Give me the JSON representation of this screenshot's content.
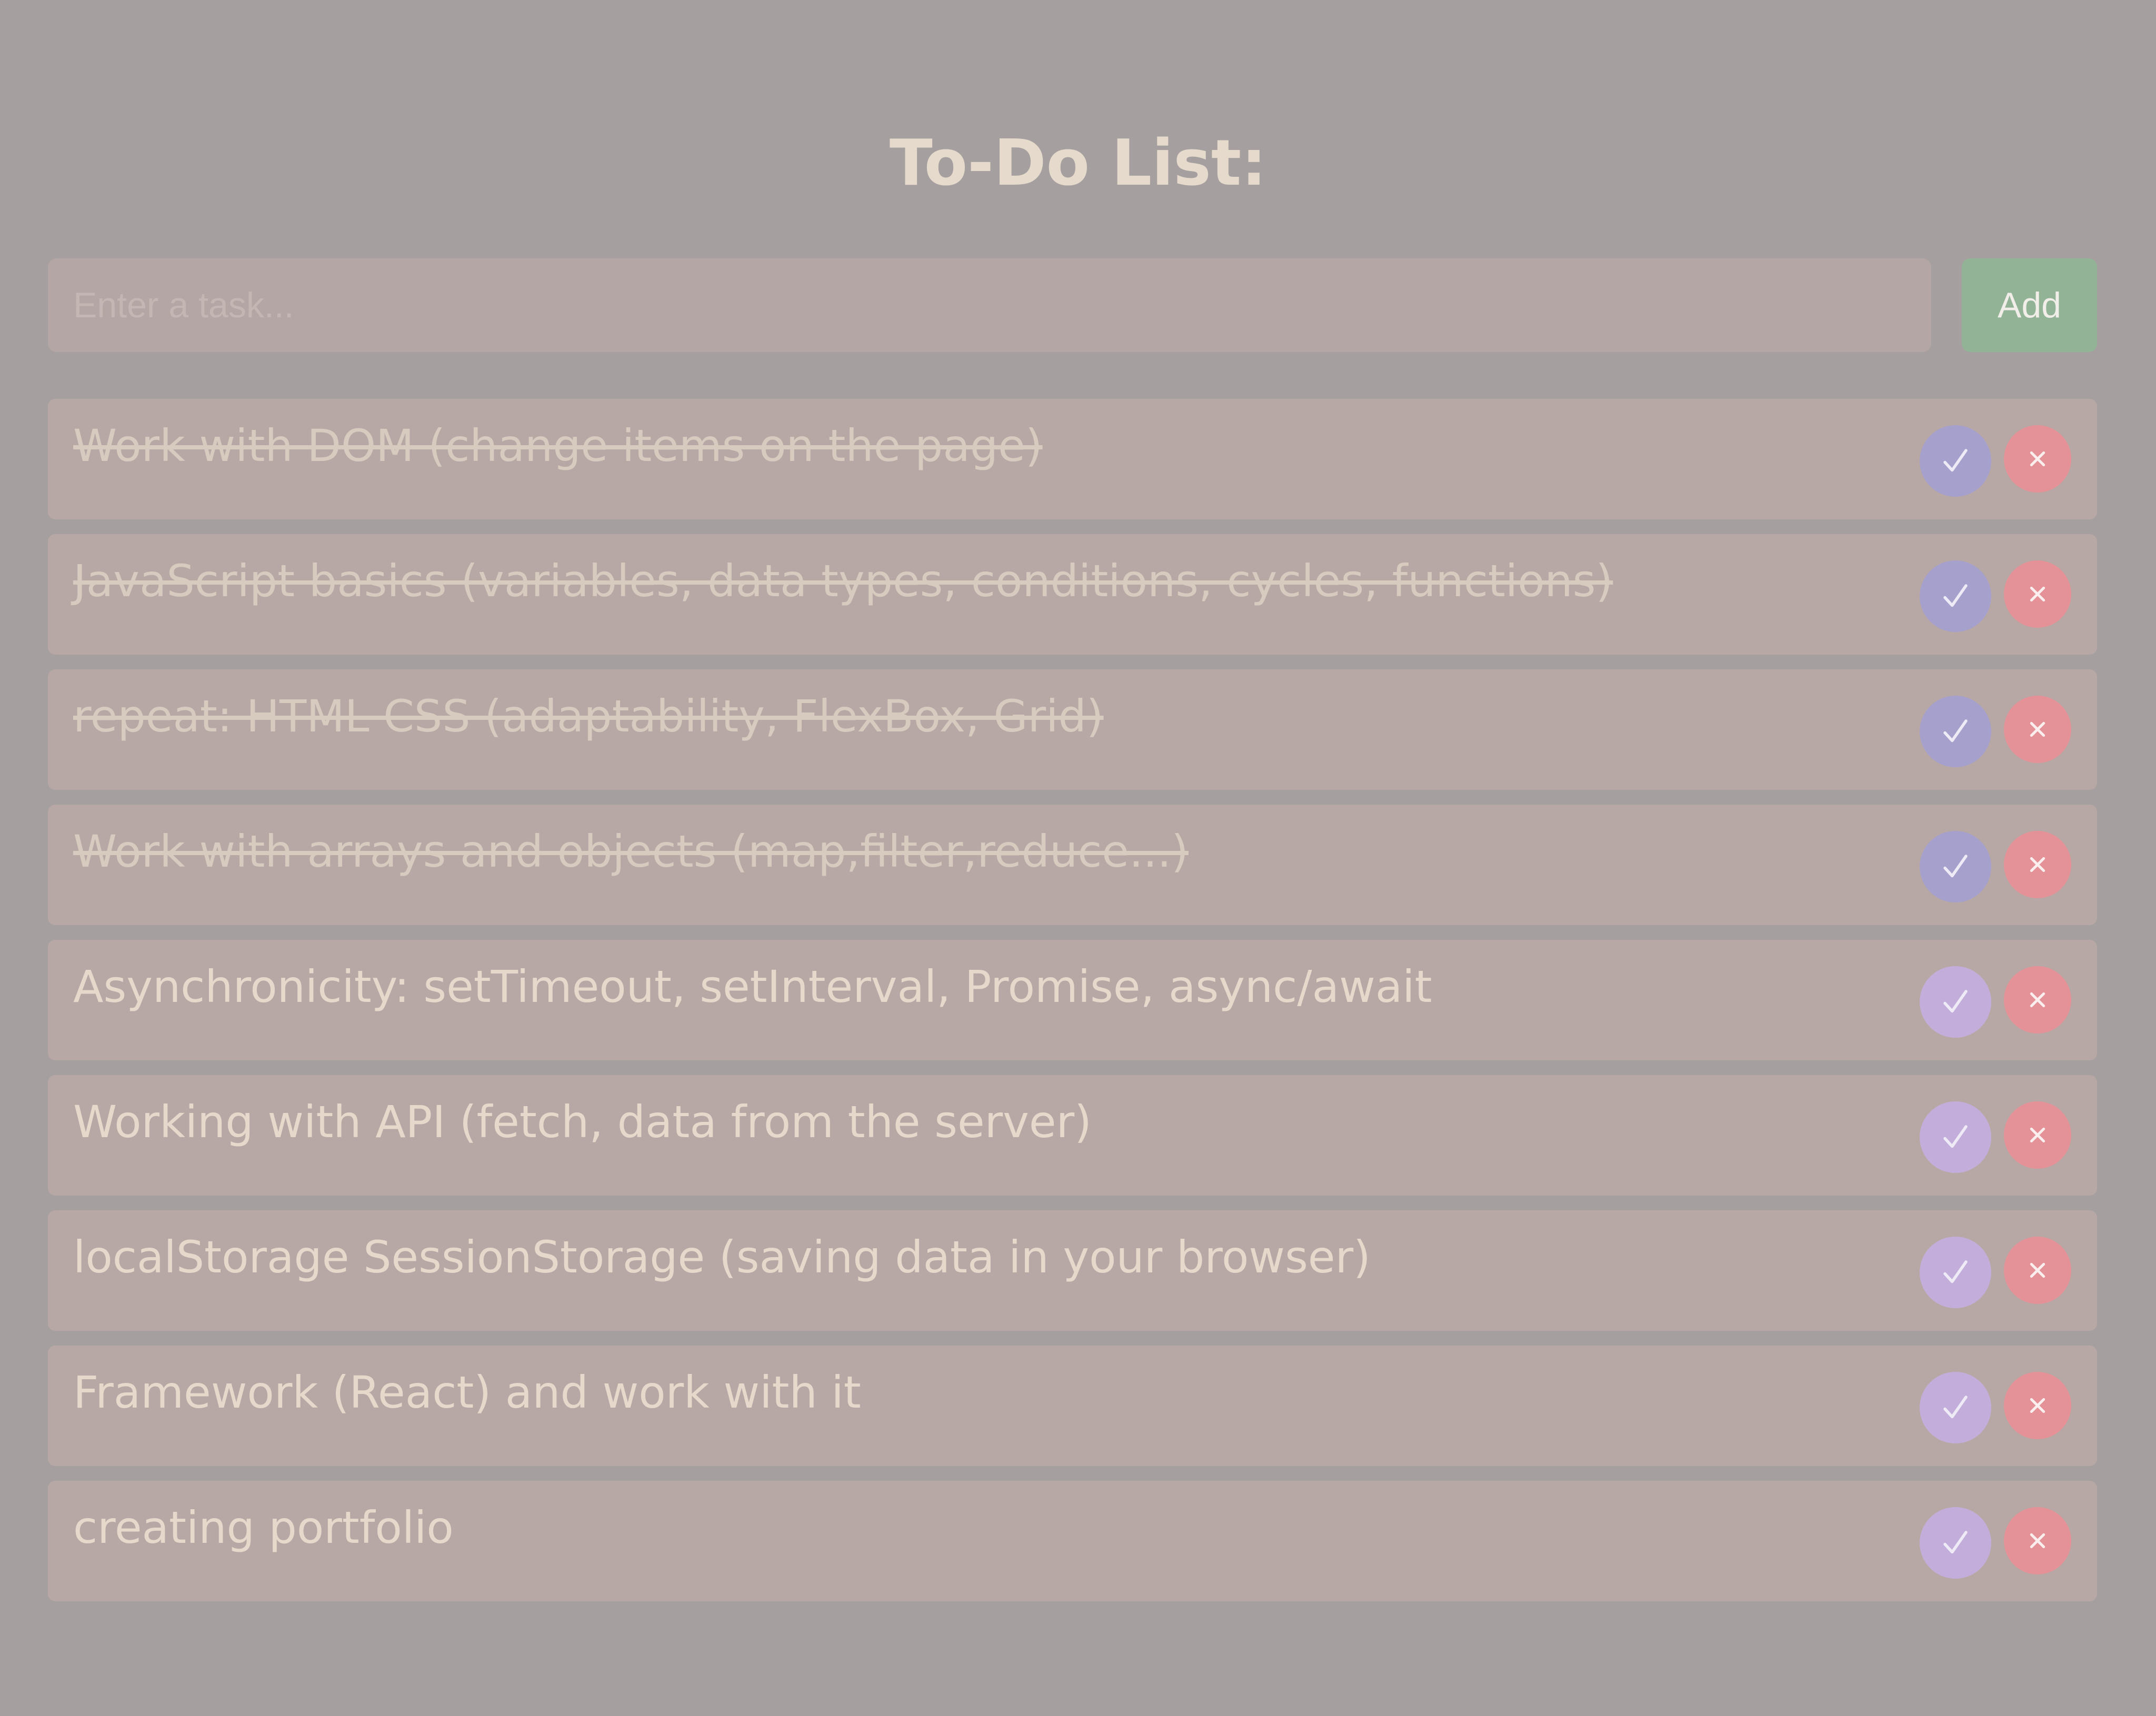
{
  "app": {
    "title": "To-Do List:"
  },
  "input": {
    "placeholder": "Enter a task...",
    "value": ""
  },
  "add_button": {
    "label": "Add"
  },
  "tasks": [
    {
      "text": "Work with DOM (change items on the page)",
      "completed": true
    },
    {
      "text": "JavaScript basics (variables, data types, conditions, cycles, functions)",
      "completed": true
    },
    {
      "text": "repeat: HTML CSS (adaptability, FlexBox, Grid)",
      "completed": true
    },
    {
      "text": "Work with arrays and objects (map,filter,reduce...)",
      "completed": true
    },
    {
      "text": "Asynchronicity: setTimeout, setInterval, Promise, async/await",
      "completed": false
    },
    {
      "text": "Working with API (fetch, data from the server)",
      "completed": false
    },
    {
      "text": "localStorage SessionStorage (saving data in your browser)",
      "completed": false
    },
    {
      "text": "Framework (React) and work with it",
      "completed": false
    },
    {
      "text": "creating portfolio",
      "completed": false
    }
  ],
  "icons": {
    "complete": "checkmark-icon",
    "delete": "close-icon"
  },
  "colors": {
    "background": "#a5a09f",
    "title": "#e6dacc",
    "item_background": "#b8a8a5",
    "add_button": "#93b396",
    "complete_button": "#c3aedb",
    "complete_button_done": "#a6a0cc",
    "delete_button": "#e49297"
  }
}
